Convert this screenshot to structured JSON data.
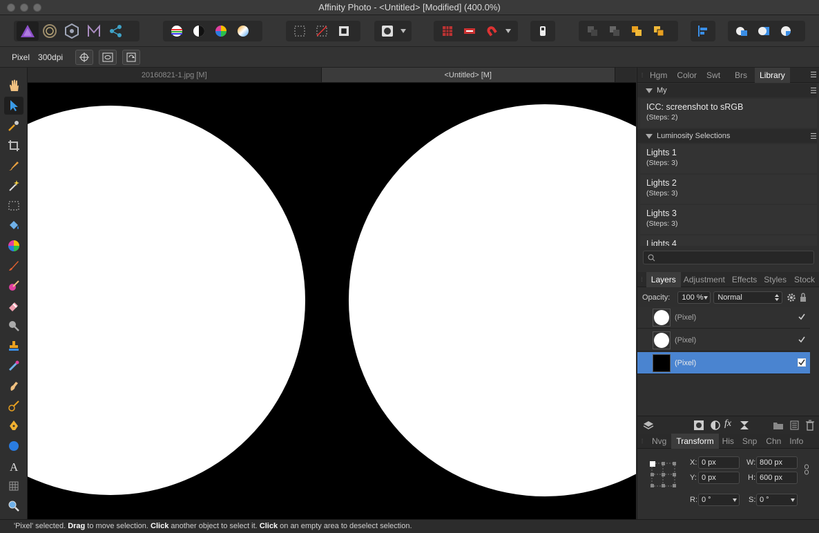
{
  "window": {
    "title": "Affinity Photo - <Untitled> [Modified] (400.0%)"
  },
  "context": {
    "unit": "Pixel",
    "dpi": "300dpi"
  },
  "doc_tabs": [
    {
      "label": "20160821-1.jpg [M]"
    },
    {
      "label": "<Untitled> [M]"
    }
  ],
  "panel_top": {
    "tabs": [
      "Hgm",
      "Color",
      "Swt",
      "Brs",
      "Library"
    ],
    "active": "Library",
    "sections": [
      {
        "title": "My",
        "items": [
          {
            "name": "ICC: screenshot to sRGB",
            "steps": "(Steps: 2)"
          }
        ]
      },
      {
        "title": "Luminosity Selections",
        "items": [
          {
            "name": "Lights 1",
            "steps": "(Steps: 3)"
          },
          {
            "name": "Lights 2",
            "steps": "(Steps: 3)"
          },
          {
            "name": "Lights 3",
            "steps": "(Steps: 3)"
          },
          {
            "name": "Lights 4",
            "steps": ""
          }
        ]
      }
    ]
  },
  "panel_layers": {
    "tabs": [
      "Layers",
      "Adjustment",
      "Effects",
      "Styles",
      "Stock"
    ],
    "active": "Layers",
    "opacity_label": "Opacity:",
    "opacity_value": "100 %",
    "blend_mode": "Normal",
    "layers": [
      {
        "name": "(Pixel)",
        "thumb": "white-circle",
        "visible": true,
        "selected": false
      },
      {
        "name": "(Pixel)",
        "thumb": "white-circle",
        "visible": true,
        "selected": false
      },
      {
        "name": "(Pixel)",
        "thumb": "black-fill",
        "visible": true,
        "selected": true
      }
    ]
  },
  "panel_transform": {
    "tabs": [
      "Nvg",
      "Transform",
      "His",
      "Snp",
      "Chn",
      "Info"
    ],
    "active": "Transform",
    "x_label": "X:",
    "x_value": "0 px",
    "y_label": "Y:",
    "y_value": "0 px",
    "w_label": "W:",
    "w_value": "800 px",
    "h_label": "H:",
    "h_value": "600 px",
    "r_label": "R:",
    "r_value": "0 °",
    "s_label": "S:",
    "s_value": "0 °"
  },
  "status": {
    "part1": "'Pixel' selected. ",
    "b1": "Drag",
    "part2": " to move selection. ",
    "b2": "Click",
    "part3": " another object to select it. ",
    "b3": "Click",
    "part4": " on an empty area to deselect selection."
  },
  "colors": {
    "accent_selection": "#4a84d0",
    "app_purple": "#7b3fb0"
  }
}
